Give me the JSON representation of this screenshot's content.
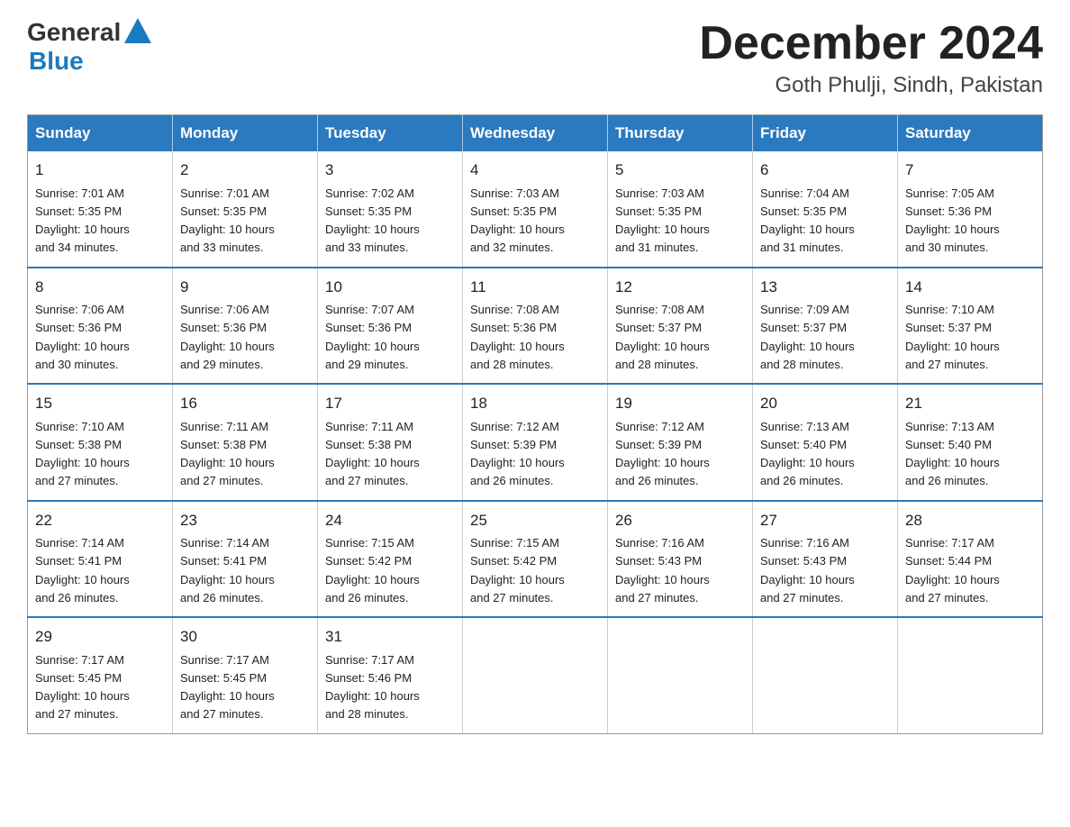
{
  "logo": {
    "text_general": "General",
    "text_blue": "Blue"
  },
  "header": {
    "month_title": "December 2024",
    "location": "Goth Phulji, Sindh, Pakistan"
  },
  "weekdays": [
    "Sunday",
    "Monday",
    "Tuesday",
    "Wednesday",
    "Thursday",
    "Friday",
    "Saturday"
  ],
  "weeks": [
    [
      {
        "day": "1",
        "sunrise": "7:01 AM",
        "sunset": "5:35 PM",
        "daylight": "10 hours and 34 minutes."
      },
      {
        "day": "2",
        "sunrise": "7:01 AM",
        "sunset": "5:35 PM",
        "daylight": "10 hours and 33 minutes."
      },
      {
        "day": "3",
        "sunrise": "7:02 AM",
        "sunset": "5:35 PM",
        "daylight": "10 hours and 33 minutes."
      },
      {
        "day": "4",
        "sunrise": "7:03 AM",
        "sunset": "5:35 PM",
        "daylight": "10 hours and 32 minutes."
      },
      {
        "day": "5",
        "sunrise": "7:03 AM",
        "sunset": "5:35 PM",
        "daylight": "10 hours and 31 minutes."
      },
      {
        "day": "6",
        "sunrise": "7:04 AM",
        "sunset": "5:35 PM",
        "daylight": "10 hours and 31 minutes."
      },
      {
        "day": "7",
        "sunrise": "7:05 AM",
        "sunset": "5:36 PM",
        "daylight": "10 hours and 30 minutes."
      }
    ],
    [
      {
        "day": "8",
        "sunrise": "7:06 AM",
        "sunset": "5:36 PM",
        "daylight": "10 hours and 30 minutes."
      },
      {
        "day": "9",
        "sunrise": "7:06 AM",
        "sunset": "5:36 PM",
        "daylight": "10 hours and 29 minutes."
      },
      {
        "day": "10",
        "sunrise": "7:07 AM",
        "sunset": "5:36 PM",
        "daylight": "10 hours and 29 minutes."
      },
      {
        "day": "11",
        "sunrise": "7:08 AM",
        "sunset": "5:36 PM",
        "daylight": "10 hours and 28 minutes."
      },
      {
        "day": "12",
        "sunrise": "7:08 AM",
        "sunset": "5:37 PM",
        "daylight": "10 hours and 28 minutes."
      },
      {
        "day": "13",
        "sunrise": "7:09 AM",
        "sunset": "5:37 PM",
        "daylight": "10 hours and 28 minutes."
      },
      {
        "day": "14",
        "sunrise": "7:10 AM",
        "sunset": "5:37 PM",
        "daylight": "10 hours and 27 minutes."
      }
    ],
    [
      {
        "day": "15",
        "sunrise": "7:10 AM",
        "sunset": "5:38 PM",
        "daylight": "10 hours and 27 minutes."
      },
      {
        "day": "16",
        "sunrise": "7:11 AM",
        "sunset": "5:38 PM",
        "daylight": "10 hours and 27 minutes."
      },
      {
        "day": "17",
        "sunrise": "7:11 AM",
        "sunset": "5:38 PM",
        "daylight": "10 hours and 27 minutes."
      },
      {
        "day": "18",
        "sunrise": "7:12 AM",
        "sunset": "5:39 PM",
        "daylight": "10 hours and 26 minutes."
      },
      {
        "day": "19",
        "sunrise": "7:12 AM",
        "sunset": "5:39 PM",
        "daylight": "10 hours and 26 minutes."
      },
      {
        "day": "20",
        "sunrise": "7:13 AM",
        "sunset": "5:40 PM",
        "daylight": "10 hours and 26 minutes."
      },
      {
        "day": "21",
        "sunrise": "7:13 AM",
        "sunset": "5:40 PM",
        "daylight": "10 hours and 26 minutes."
      }
    ],
    [
      {
        "day": "22",
        "sunrise": "7:14 AM",
        "sunset": "5:41 PM",
        "daylight": "10 hours and 26 minutes."
      },
      {
        "day": "23",
        "sunrise": "7:14 AM",
        "sunset": "5:41 PM",
        "daylight": "10 hours and 26 minutes."
      },
      {
        "day": "24",
        "sunrise": "7:15 AM",
        "sunset": "5:42 PM",
        "daylight": "10 hours and 26 minutes."
      },
      {
        "day": "25",
        "sunrise": "7:15 AM",
        "sunset": "5:42 PM",
        "daylight": "10 hours and 27 minutes."
      },
      {
        "day": "26",
        "sunrise": "7:16 AM",
        "sunset": "5:43 PM",
        "daylight": "10 hours and 27 minutes."
      },
      {
        "day": "27",
        "sunrise": "7:16 AM",
        "sunset": "5:43 PM",
        "daylight": "10 hours and 27 minutes."
      },
      {
        "day": "28",
        "sunrise": "7:17 AM",
        "sunset": "5:44 PM",
        "daylight": "10 hours and 27 minutes."
      }
    ],
    [
      {
        "day": "29",
        "sunrise": "7:17 AM",
        "sunset": "5:45 PM",
        "daylight": "10 hours and 27 minutes."
      },
      {
        "day": "30",
        "sunrise": "7:17 AM",
        "sunset": "5:45 PM",
        "daylight": "10 hours and 27 minutes."
      },
      {
        "day": "31",
        "sunrise": "7:17 AM",
        "sunset": "5:46 PM",
        "daylight": "10 hours and 28 minutes."
      },
      null,
      null,
      null,
      null
    ]
  ],
  "labels": {
    "sunrise": "Sunrise:",
    "sunset": "Sunset:",
    "daylight": "Daylight:"
  }
}
